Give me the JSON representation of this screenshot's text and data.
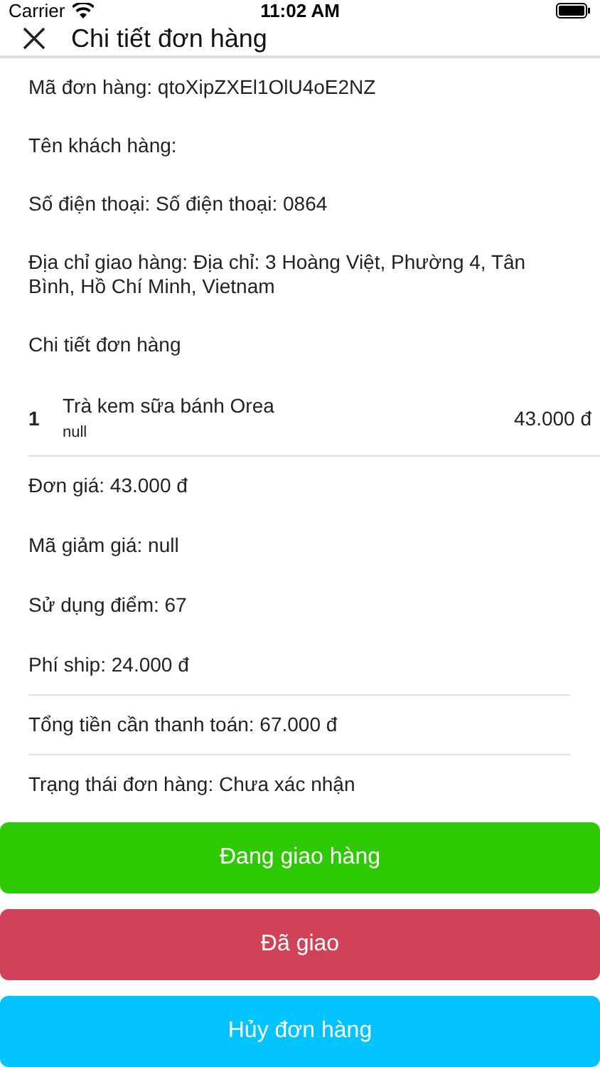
{
  "status_bar": {
    "carrier": "Carrier",
    "time": "11:02 AM"
  },
  "header": {
    "title": "Chi tiết đơn hàng"
  },
  "info": [
    "Mã đơn hàng: qtoXipZXEl1OlU4oE2NZ",
    "Tên khách hàng:",
    "Số điện thoại: Số điện thoại: 0864",
    "Địa chỉ giao hàng: Địa chỉ: 3 Hoàng Việt, Phường 4, Tân Bình, Hồ Chí Minh, Vietnam",
    "Chi tiết đơn hàng"
  ],
  "items": [
    {
      "quantity": "1",
      "name": "Trà kem sữa bánh Orea",
      "note": "null",
      "price": "43.000 đ"
    }
  ],
  "summary": [
    {
      "text": "Đơn giá: 43.000 đ",
      "divided": false
    },
    {
      "text": "Mã giảm giá: null",
      "divided": false
    },
    {
      "text": "Sử dụng điểm: 67",
      "divided": false
    },
    {
      "text": "Phí ship: 24.000 đ",
      "divided": true
    },
    {
      "text": "Tổng tiền cần thanh toán: 67.000 đ",
      "divided": true
    },
    {
      "text": "Trạng thái đơn hàng: Chưa xác nhận",
      "divided": false
    }
  ],
  "buttons": [
    {
      "label": "Đang giao hàng",
      "color": "#2dc902"
    },
    {
      "label": "Đã giao",
      "color": "#d04257"
    },
    {
      "label": "Hủy đơn hàng",
      "color": "#00c3ff"
    }
  ]
}
